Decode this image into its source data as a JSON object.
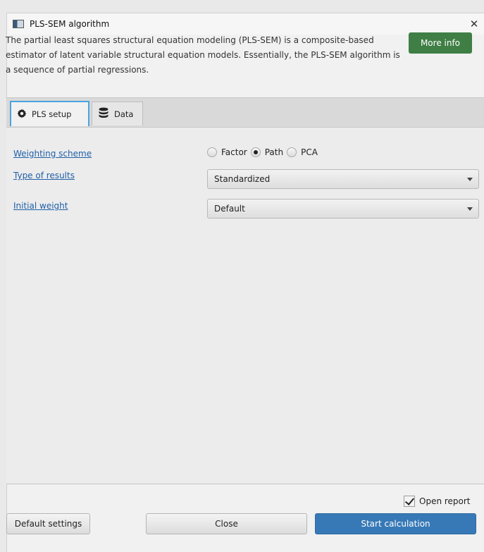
{
  "window": {
    "title": "PLS-SEM algorithm",
    "close_glyph": "✕"
  },
  "description": "The partial least squares structural equation modeling (PLS-SEM) is a composite-based estimator of latent variable structural equation models. Essentially, the PLS-SEM algorithm is a sequence of partial regressions.",
  "more_info_label": "More info",
  "tabs": [
    {
      "label": "PLS setup",
      "icon": "gear-icon",
      "active": true
    },
    {
      "label": "Data",
      "icon": "database-icon",
      "active": false
    }
  ],
  "settings": {
    "weighting_scheme": {
      "label": "Weighting scheme",
      "options": [
        "Factor",
        "Path",
        "PCA"
      ],
      "selected": "Path"
    },
    "type_of_results": {
      "label": "Type of results",
      "value": "Standardized"
    },
    "initial_weight": {
      "label": "Initial weight",
      "value": "Default"
    }
  },
  "footer": {
    "open_report_label": "Open report",
    "open_report_checked": true,
    "default_settings_label": "Default settings",
    "close_label": "Close",
    "start_label": "Start calculation"
  },
  "colors": {
    "accent_green": "#3f7f45",
    "accent_blue": "#3779b6",
    "link": "#1f5fa8",
    "tab_focus": "#4aa3df"
  }
}
